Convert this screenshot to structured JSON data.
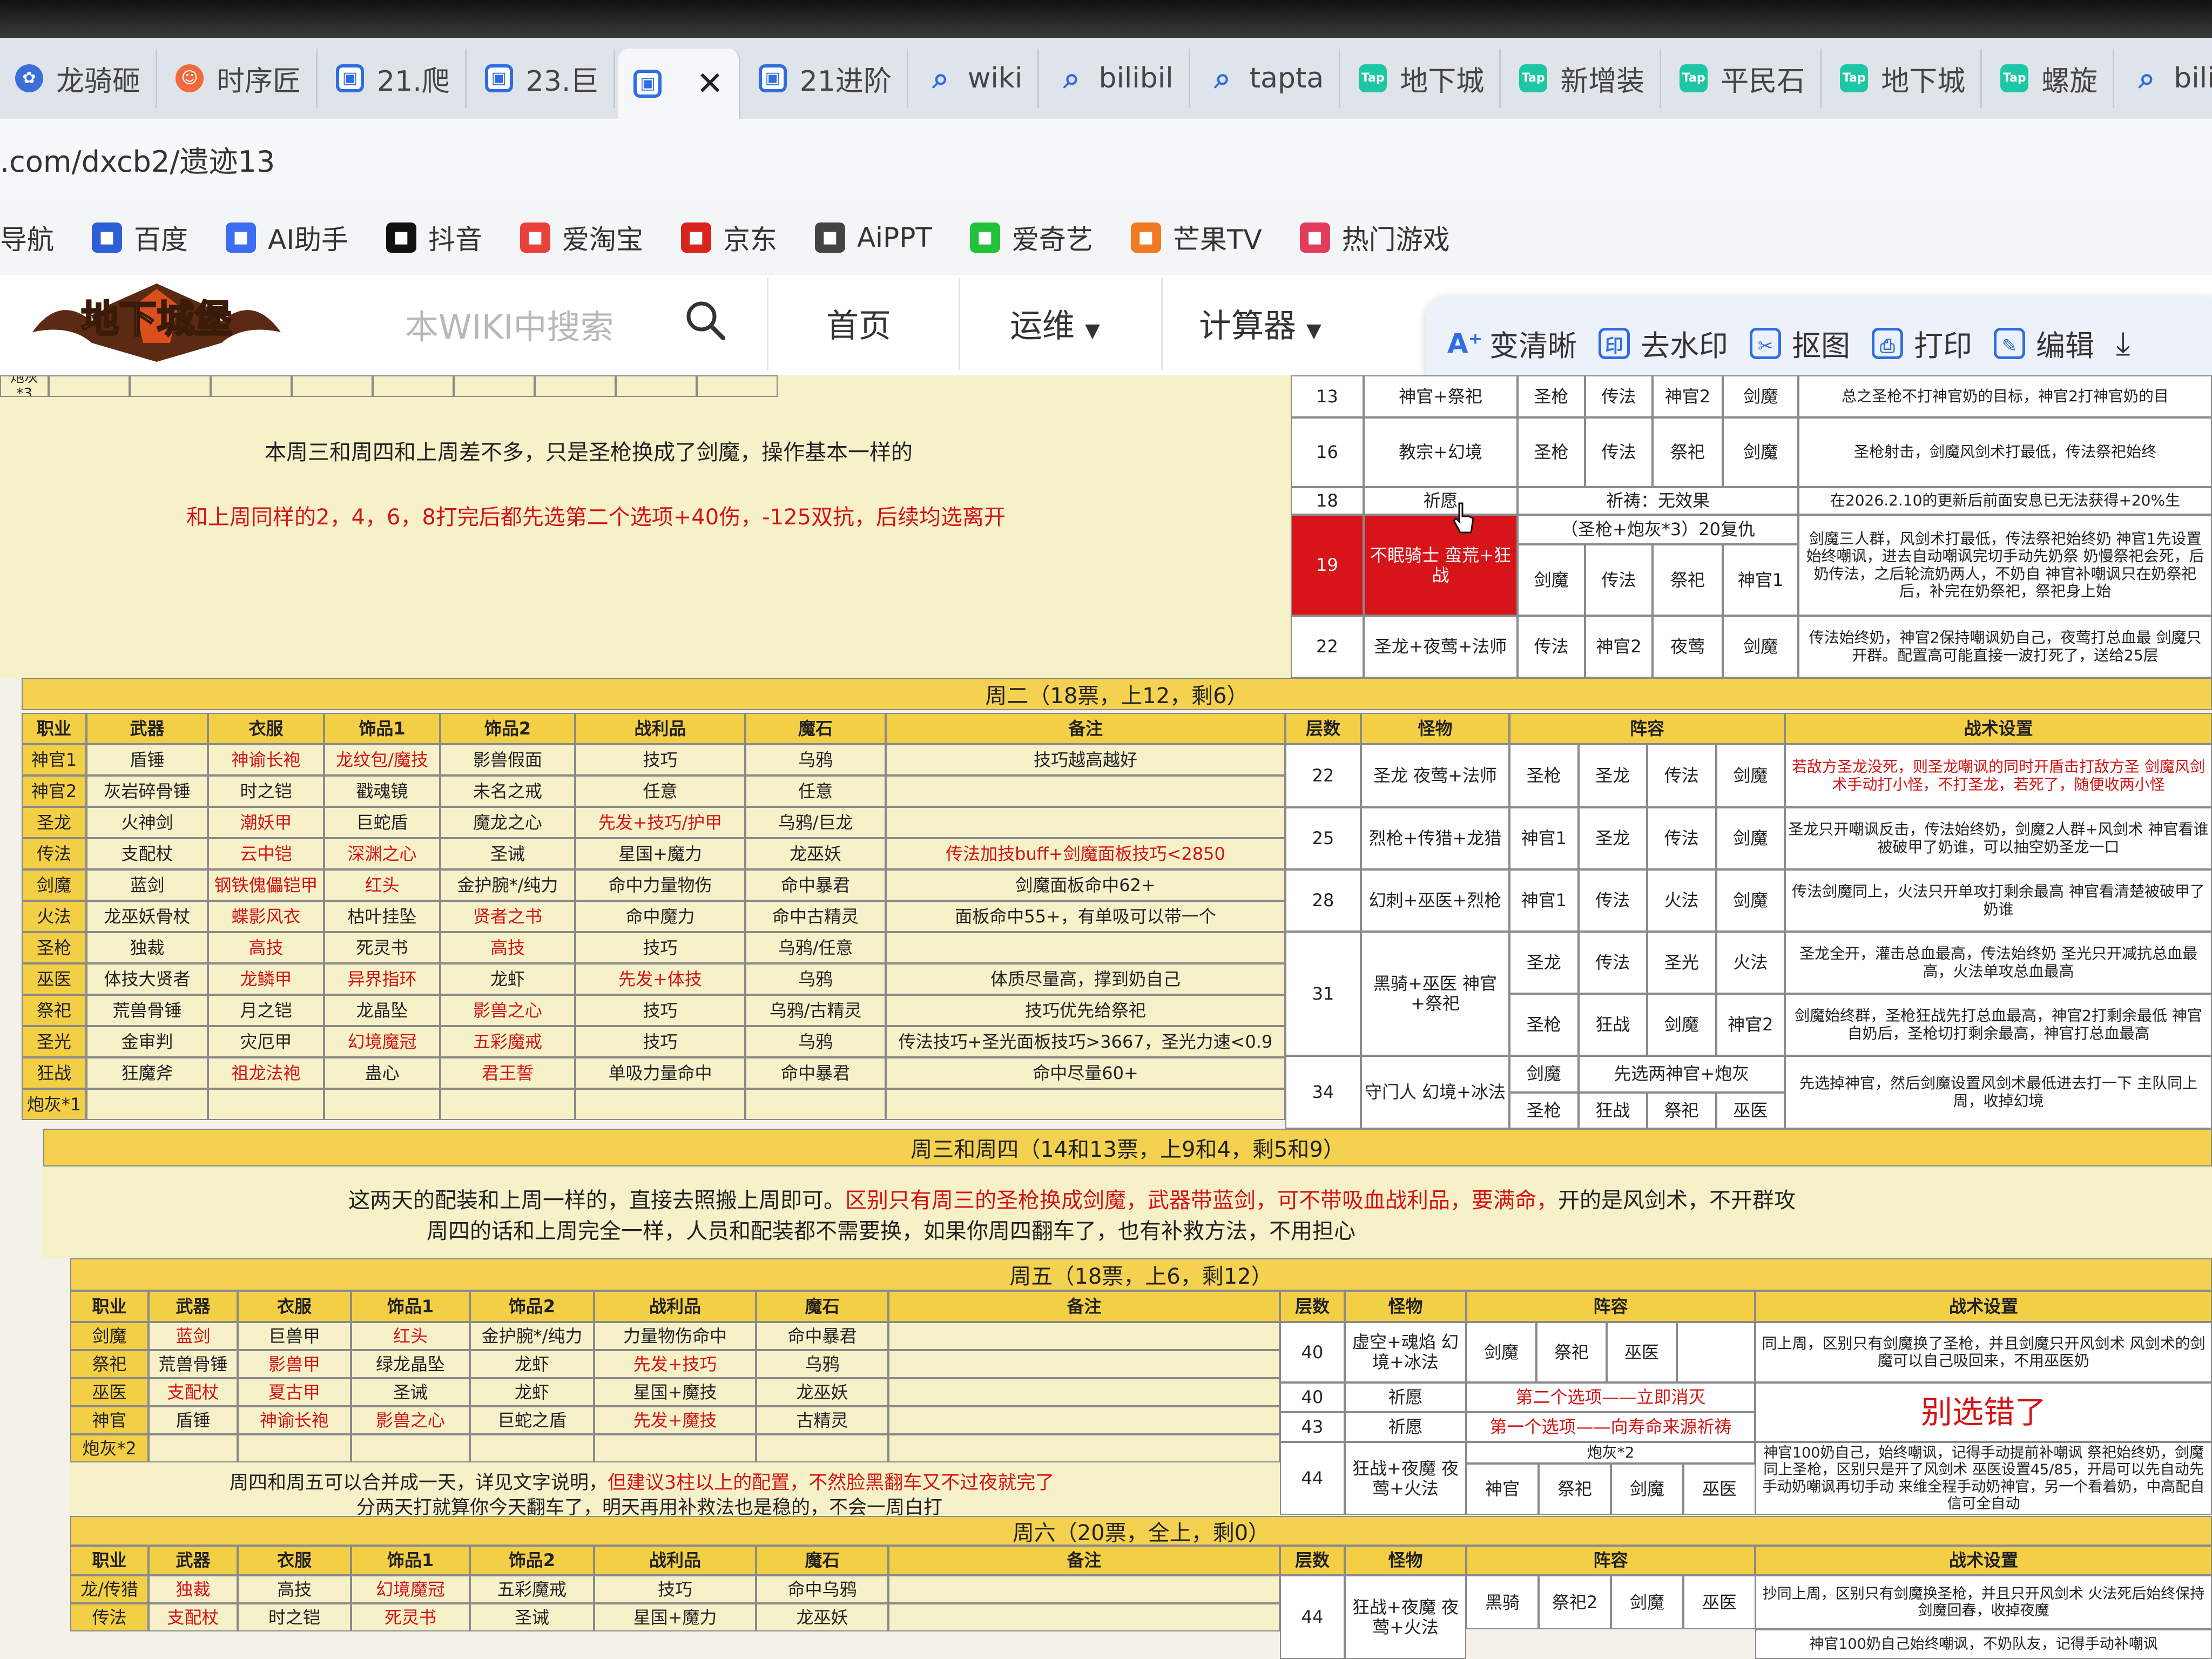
{
  "browser": {
    "tabs": [
      {
        "icon": "paw",
        "label": "龙骑砸"
      },
      {
        "icon": "face",
        "label": "时序匠"
      },
      {
        "icon": "cal",
        "label": "21.爬"
      },
      {
        "icon": "cal",
        "label": "23.巨"
      },
      {
        "icon": "cal",
        "label": "",
        "active": true
      },
      {
        "icon": "cal",
        "label": "21进阶"
      },
      {
        "icon": "srch",
        "label": "wiki"
      },
      {
        "icon": "srch",
        "label": "bilibil"
      },
      {
        "icon": "srch",
        "label": "tapta"
      },
      {
        "icon": "tap",
        "label": "地下城"
      },
      {
        "icon": "tap",
        "label": "新增装"
      },
      {
        "icon": "tap",
        "label": "平民石"
      },
      {
        "icon": "tap",
        "label": "地下城"
      },
      {
        "icon": "tap",
        "label": "螺旋"
      },
      {
        "icon": "srch",
        "label": "bilibi"
      }
    ],
    "url": ".com/dxcb2/遗迹13",
    "bookmarks": [
      {
        "label": "导航",
        "color": "#ffffff"
      },
      {
        "label": "百度",
        "color": "#2f5fd6"
      },
      {
        "label": "AI助手",
        "color": "#3d6df2"
      },
      {
        "label": "抖音",
        "color": "#111111"
      },
      {
        "label": "爱淘宝",
        "color": "#e8423b"
      },
      {
        "label": "京东",
        "color": "#d9231d"
      },
      {
        "label": "AiPPT",
        "color": "#444444"
      },
      {
        "label": "爱奇艺",
        "color": "#21c13a"
      },
      {
        "label": "芒果TV",
        "color": "#f07a22"
      },
      {
        "label": "热门游戏",
        "color": "#e23c5a"
      }
    ]
  },
  "site": {
    "logo_text": "地下城堡",
    "search_placeholder": "本WIKI中搜索",
    "nav": [
      "首页",
      "运维",
      "计算器"
    ],
    "tools": [
      "变清晰",
      "去水印",
      "抠图",
      "打印",
      "编辑"
    ]
  },
  "top": {
    "row_label": "炮灰*3",
    "note1": "本周三和周四和上周差不多，只是圣枪换成了剑魔，操作基本一样的",
    "note2": "和上周同样的2，4，6，8打完后都先选第二个选项+40伤，-125双抗，后续均选离开",
    "right_rows": [
      {
        "floor": "13",
        "monster": "神官+祭祀",
        "c": [
          "圣枪",
          "传法",
          "神官2",
          "剑魔"
        ],
        "tactic": "总之圣枪不打神官奶的目标，神官2打神官奶的目"
      },
      {
        "floor": "16",
        "monster": "教宗+幻境",
        "c": [
          "圣枪",
          "传法",
          "祭祀",
          "剑魔"
        ],
        "tactic": "圣枪射击，剑魔风剑术打最低，传法祭祀始终"
      },
      {
        "floor": "18",
        "monster": "祈愿",
        "c": [
          "祈祷：无效果"
        ],
        "tactic": "在2026.2.10的更新后前面安息已无法获得+20%生"
      },
      {
        "floor": "19",
        "monster": "不眠骑士 蛮荒+狂战",
        "c": [
          "剑魔",
          "传法",
          "祭祀",
          "神官1"
        ],
        "top": "（圣枪+炮灰*3）20复仇",
        "tactic": "剑魔三人群，风剑术打最低，传法祭祀始终奶 神官1先设置始终嘲讽，进去自动嘲讽完切手动先奶祭 奶慢祭祀会死，后奶传法，之后轮流奶两人，不奶自 神官补嘲讽只在奶祭祀后，补完在奶祭祀，祭祀身上始"
      },
      {
        "floor": "22",
        "monster": "圣龙+夜莺+法师",
        "c": [
          "传法",
          "神官2",
          "夜莺",
          "剑魔"
        ],
        "tactic": "传法始终奶，神官2保持嘲讽奶自己，夜莺打总血最 剑魔只开群。配置高可能直接一波打死了，送给25层"
      }
    ]
  },
  "tue": {
    "band": "周二（18票，上12，剩6）",
    "headers": [
      "职业",
      "武器",
      "衣服",
      "饰品1",
      "饰品2",
      "战利品",
      "魔石",
      "备注",
      "层数",
      "怪物",
      "阵容",
      "战术设置"
    ],
    "rows": [
      [
        "神官1",
        "盾锤",
        "神谕长袍",
        "龙纹包/魔技",
        "影兽假面",
        "技巧",
        "乌鸦",
        "技巧越高越好"
      ],
      [
        "神官2",
        "灰岩碎骨锤",
        "时之铠",
        "戳魂镜",
        "未名之戒",
        "任意",
        "任意",
        ""
      ],
      [
        "圣龙",
        "火神剑",
        "潮妖甲",
        "巨蛇盾",
        "魔龙之心",
        "先发+技巧/护甲",
        "乌鸦/巨龙",
        ""
      ],
      [
        "传法",
        "支配杖",
        "云中铠",
        "深渊之心",
        "圣诫",
        "星国+魔力",
        "龙巫妖",
        "传法加技buff+剑魔面板技巧<2850"
      ],
      [
        "剑魔",
        "蓝剑",
        "钢铁傀儡铠甲",
        "红头",
        "金护腕*/纯力",
        "命中力量物伤",
        "命中暴君",
        "剑魔面板命中62+"
      ],
      [
        "火法",
        "龙巫妖骨杖",
        "蝶影风衣",
        "枯叶挂坠",
        "贤者之书",
        "命中魔力",
        "命中古精灵",
        "面板命中55+，有单吸可以带一个"
      ],
      [
        "圣枪",
        "独裁",
        "高技",
        "死灵书",
        "高技",
        "技巧",
        "乌鸦/任意",
        ""
      ],
      [
        "巫医",
        "体技大贤者",
        "龙鳞甲",
        "异界指环",
        "龙虾",
        "先发+体技",
        "乌鸦",
        "体质尽量高，撑到奶自己"
      ],
      [
        "祭祀",
        "荒兽骨锤",
        "月之铠",
        "龙晶坠",
        "影兽之心",
        "技巧",
        "乌鸦/古精灵",
        "技巧优先给祭祀"
      ],
      [
        "圣光",
        "金审判",
        "灾厄甲",
        "幻境魔冠",
        "五彩魔戒",
        "技巧",
        "乌鸦",
        "传法技巧+圣光面板技巧>3667，圣光力速<0.9"
      ],
      [
        "狂战",
        "狂魔斧",
        "祖龙法袍",
        "蛊心",
        "君王誓",
        "单吸力量命中",
        "命中暴君",
        "命中尽量60+"
      ],
      [
        "炮灰*1",
        "",
        "",
        "",
        "",
        "",
        "",
        ""
      ]
    ],
    "red": [
      [
        0,
        2
      ],
      [
        0,
        3
      ],
      [
        2,
        2
      ],
      [
        2,
        5
      ],
      [
        3,
        2
      ],
      [
        3,
        3
      ],
      [
        4,
        2
      ],
      [
        4,
        3
      ],
      [
        5,
        2
      ],
      [
        5,
        4
      ],
      [
        6,
        2
      ],
      [
        6,
        4
      ],
      [
        7,
        2
      ],
      [
        7,
        3
      ],
      [
        7,
        5
      ],
      [
        8,
        4
      ],
      [
        9,
        3
      ],
      [
        9,
        4
      ],
      [
        10,
        2
      ],
      [
        10,
        4
      ]
    ],
    "right": [
      {
        "floor": "22",
        "monster": "圣龙 夜莺+法师",
        "c": [
          "圣枪",
          "圣龙",
          "传法",
          "剑魔"
        ],
        "tactic": "若敌方圣龙没死，则圣龙嘲讽的同时开盾击打敌方圣 剑魔风剑术手动打小怪，不打圣龙，若死了，随便收两小怪"
      },
      {
        "floor": "25",
        "monster": "烈枪+传猎+龙猎",
        "c": [
          "神官1",
          "圣龙",
          "传法",
          "剑魔"
        ],
        "tactic": "圣龙只开嘲讽反击，传法始终奶，剑魔2人群+风剑术 神官看谁被破甲了奶谁，可以抽空奶圣龙一口"
      },
      {
        "floor": "28",
        "monster": "幻刺+巫医+烈枪",
        "c": [
          "神官1",
          "传法",
          "火法",
          "剑魔"
        ],
        "tactic": "传法剑魔同上，火法只开单攻打剩余最高 神官看清楚被破甲了奶谁"
      },
      {
        "floor": "31",
        "monster": "黑骑+巫医 神官+祭祀",
        "c": [
          "圣龙",
          "传法",
          "圣光",
          "火法"
        ],
        "c2": [
          "圣枪",
          "狂战",
          "剑魔",
          "神官2"
        ],
        "tactic": "圣龙全开，灌击总血最高，传法始终奶 圣光只开减抗总血最高，火法单攻总血最高",
        "tactic2": "剑魔始终群，圣枪狂战先打总血最高，神官2打剩余最低 神官自奶后，圣枪切打剩余最高，神官打总血最高"
      },
      {
        "floor": "34",
        "monster": "守门人 幻境+冰法",
        "c": [
          "剑魔",
          "先选两神官+炮灰"
        ],
        "c2": [
          "圣枪",
          "狂战",
          "祭祀",
          "巫医"
        ],
        "tactic": "先选掉神官，然后剑魔设置风剑术最低进去打一下 主队同上周，收掉幻境"
      }
    ]
  },
  "wedthu": {
    "band": "周三和周四（14和13票，上9和4，剩5和9）",
    "line1a": "这两天的配装和上周一样的，直接去照搬上周即可。",
    "line1b": "区别只有周三的圣枪换成剑魔，武器带蓝剑，可不带吸血战利品，要满命，",
    "line1c": "开的是风剑术，不开群攻",
    "line2": "周四的话和上周完全一样，人员和配装都不需要换，如果你周四翻车了，也有补救方法，不用担心"
  },
  "fri": {
    "band": "周五（18票，上6，剩12）",
    "headers": [
      "职业",
      "武器",
      "衣服",
      "饰品1",
      "饰品2",
      "战利品",
      "魔石",
      "备注",
      "层数",
      "怪物",
      "阵容",
      "战术设置"
    ],
    "rows": [
      [
        "剑魔",
        "蓝剑",
        "巨兽甲",
        "红头",
        "金护腕*/纯力",
        "力量物伤命中",
        "命中暴君"
      ],
      [
        "祭祀",
        "荒兽骨锤",
        "影兽甲",
        "绿龙晶坠",
        "龙虾",
        "先发+技巧",
        "乌鸦"
      ],
      [
        "巫医",
        "支配杖",
        "夏古甲",
        "圣诫",
        "龙虾",
        "星国+魔技",
        "龙巫妖"
      ],
      [
        "神官",
        "盾锤",
        "神谕长袍",
        "影兽之心",
        "巨蛇之盾",
        "先发+魔技",
        "古精灵"
      ],
      [
        "炮灰*2",
        "",
        "",
        "",
        "",
        "",
        ""
      ]
    ],
    "red": [
      [
        0,
        1
      ],
      [
        0,
        3
      ],
      [
        1,
        2
      ],
      [
        1,
        5
      ],
      [
        2,
        1
      ],
      [
        2,
        2
      ],
      [
        3,
        2
      ],
      [
        3,
        3
      ],
      [
        3,
        5
      ]
    ],
    "r40a_monster": "虚空+魂焰 幻境+冰法",
    "r40a_c": [
      "剑魔",
      "祭祀",
      "巫医"
    ],
    "r40a_tactic": "同上周，区别只有剑魔换了圣枪，并且剑魔只开风剑术 风剑术的剑魔可以自己吸回来，不用巫医奶",
    "r40b_monster": "祈愿",
    "r40b_opt": "第二个选项——立即消灭",
    "r43_monster": "祈愿",
    "r43_opt": "第一个选项——向寿命来源祈祷",
    "warn": "别选错了",
    "pao": "炮灰*2",
    "r44_monster": "狂战+夜魔 夜莺+火法",
    "r44_c": [
      "神官",
      "祭祀",
      "剑魔",
      "巫医"
    ],
    "r44_tactic": "神官100奶自己，始终嘲讽，记得手动提前补嘲讽 祭祀始终奶，剑魔同上圣枪，区别只是开了风剑术 巫医设置45/85，开局可以先自动先手动奶嘲讽再切手动 来维全程手动奶神官，另一个看着奶，中高配自信可全自动",
    "floors": [
      "40",
      "40",
      "43",
      "44"
    ],
    "note_a": "周四和周五可以合并成一天，详见文字说明，",
    "note_b": "但建议3柱以上的配置，不然脸黑翻车又不过夜就完了",
    "note_c": "分两天打就算你今天翻车了，明天再用补救法也是稳的，不会一周白打"
  },
  "sat": {
    "band": "周六（20票，全上，剩0）",
    "headers": [
      "职业",
      "武器",
      "衣服",
      "饰品1",
      "饰品2",
      "战利品",
      "魔石",
      "备注",
      "层数",
      "怪物",
      "阵容",
      "战术设置"
    ],
    "rows": [
      [
        "龙/传猎",
        "独裁",
        "高技",
        "幻境魔冠",
        "五彩魔戒",
        "技巧",
        "命中乌鸦"
      ],
      [
        "传法",
        "支配杖",
        "时之铠",
        "死灵书",
        "圣诫",
        "星国+魔力",
        "龙巫妖"
      ]
    ],
    "red": [
      [
        0,
        1
      ],
      [
        0,
        3
      ],
      [
        1,
        1
      ],
      [
        1,
        3
      ]
    ],
    "floor": "44",
    "monster": "狂战+夜魔 夜莺+火法",
    "c": [
      "黑骑",
      "祭祀2",
      "剑魔",
      "巫医"
    ],
    "tactic": "抄同上周，区别只有剑魔换圣枪，并且只开风剑术 火法死后始终保持剑魔回春，收掉夜魔",
    "tactic2": "神官100奶自己始终嘲讽，不奶队友，记得手动补嘲讽"
  }
}
